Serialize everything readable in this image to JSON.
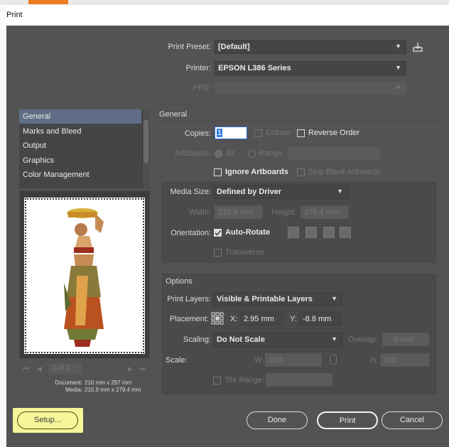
{
  "window": {
    "title": "Print"
  },
  "top": {
    "preset_label": "Print Preset:",
    "preset_value": "[Default]",
    "printer_label": "Printer:",
    "printer_value": "EPSON L386 Series",
    "ppd_label": "PPD:",
    "ppd_value": ""
  },
  "sidebar": {
    "items": [
      {
        "label": "General",
        "selected": true
      },
      {
        "label": "Marks and Bleed"
      },
      {
        "label": "Output"
      },
      {
        "label": "Graphics"
      },
      {
        "label": "Color Management"
      }
    ],
    "pager": {
      "first": "⏮",
      "prev": "◀",
      "page": "1 of 1",
      "next": "▶",
      "last": "⏭"
    },
    "document_label": "Document:",
    "document_value": "210 mm x 297 mm",
    "media_label": "Media:",
    "media_value": "215.9 mm x 279.4 mm"
  },
  "general": {
    "section_title": "General",
    "copies_label": "Copies:",
    "copies_value": "1",
    "collate_label": "Collate",
    "collate_checked": false,
    "reverse_label": "Reverse Order",
    "reverse_checked": false,
    "artboards_label": "Artboards:",
    "all_label": "All",
    "range_label": "Range:",
    "range_value": "",
    "ignore_label": "Ignore Artboards",
    "ignore_checked": false,
    "skip_label": "Skip Blank Artboards",
    "skip_checked": false
  },
  "media": {
    "size_label": "Media Size:",
    "size_value": "Defined by Driver",
    "width_label": "Width:",
    "width_value": "215.9 mm",
    "height_label": "Height:",
    "height_value": "279.4 mm",
    "orientation_label": "Orientation:",
    "autorotate_label": "Auto-Rotate",
    "autorotate_checked": true,
    "transverse_label": "Transverse",
    "transverse_checked": false
  },
  "options": {
    "section_title": "Options",
    "layers_label": "Print Layers:",
    "layers_value": "Visible & Printable Layers",
    "placement_label": "Placement:",
    "x_label": "X:",
    "x_value": "2.95 mm",
    "y_label": "Y:",
    "y_value": "-8.8 mm",
    "scaling_label": "Scaling:",
    "scaling_value": "Do Not Scale",
    "overlap_label": "Overlap:",
    "overlap_value": "0 mm",
    "scale_label": "Scale:",
    "w_label": "W:",
    "w_value": "100",
    "h_label": "H:",
    "h_value": "100",
    "tile_label": "Tile Range:",
    "tile_value": ""
  },
  "buttons": {
    "setup": "Setup...",
    "done": "Done",
    "print": "Print",
    "cancel": "Cancel"
  },
  "colors": {
    "dialog_bg": "#535353",
    "selection": "#5f6e86",
    "highlight": "#f6f59a",
    "accent": "#ef7d22"
  }
}
